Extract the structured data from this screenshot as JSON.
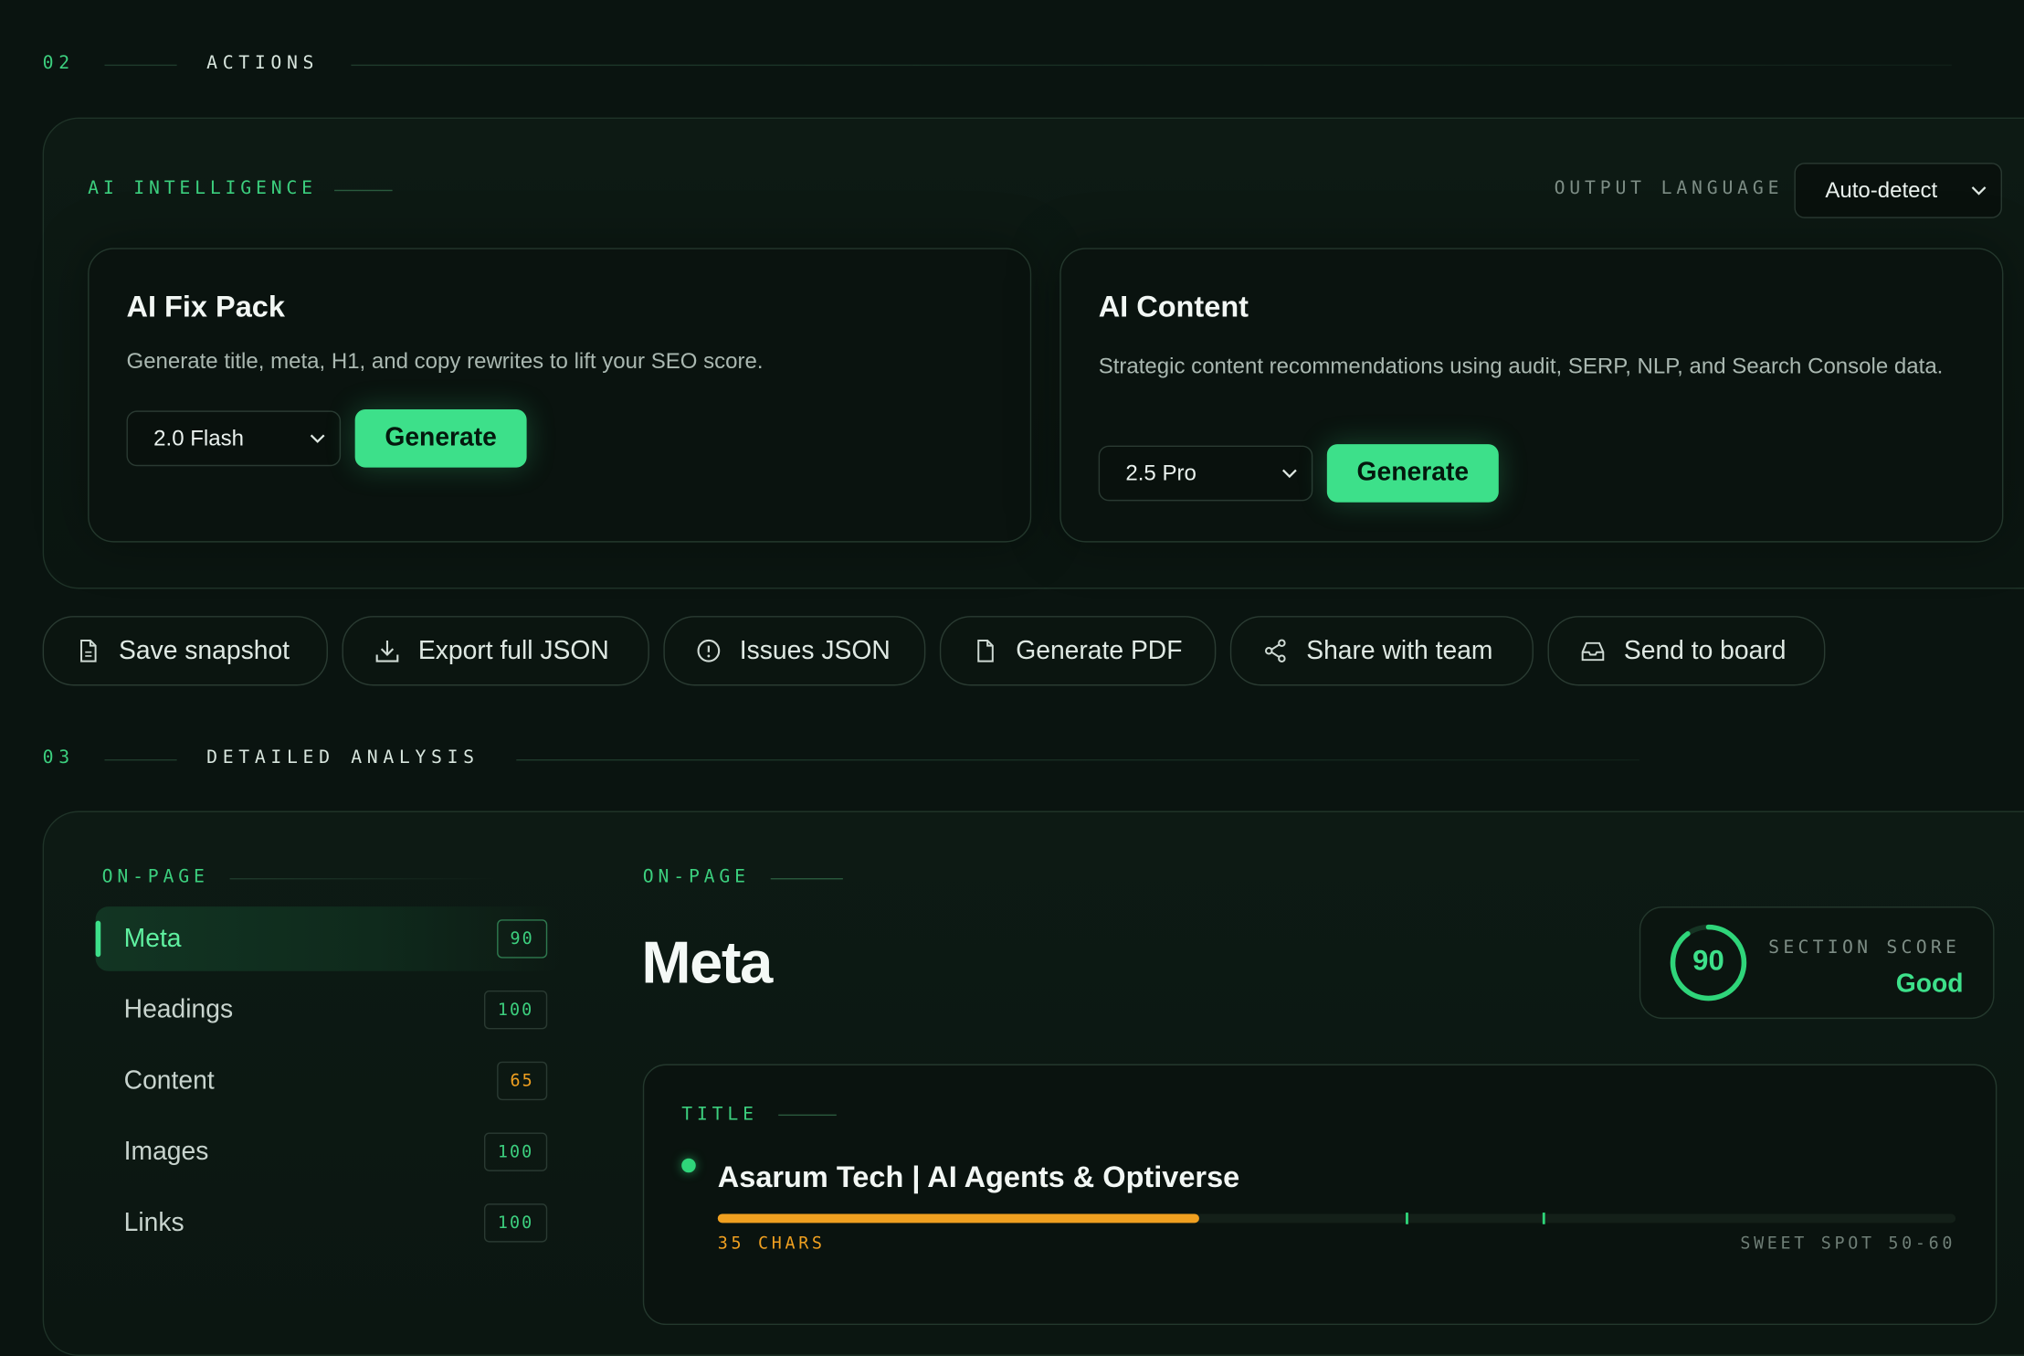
{
  "sections": {
    "actions": {
      "num": "02",
      "title": "ACTIONS"
    },
    "detailed": {
      "num": "03",
      "title": "DETAILED ANALYSIS"
    }
  },
  "ai_panel": {
    "eyebrow": "AI INTELLIGENCE",
    "output_language_label": "OUTPUT LANGUAGE",
    "output_language_value": "Auto-detect",
    "fix_pack": {
      "title": "AI Fix Pack",
      "description": "Generate title, meta, H1, and copy rewrites to lift your SEO score.",
      "model": "2.0 Flash",
      "button": "Generate"
    },
    "content": {
      "title": "AI Content",
      "description": "Strategic content recommendations using audit, SERP, NLP, and Search Console data.",
      "model": "2.5 Pro",
      "button": "Generate"
    }
  },
  "actions": [
    {
      "label": "Save snapshot",
      "icon": "document-icon"
    },
    {
      "label": "Export full JSON",
      "icon": "download-icon"
    },
    {
      "label": "Issues JSON",
      "icon": "alert-circle-icon"
    },
    {
      "label": "Generate PDF",
      "icon": "file-icon"
    },
    {
      "label": "Share with team",
      "icon": "share-icon"
    },
    {
      "label": "Send to board",
      "icon": "inbox-icon"
    }
  ],
  "sidebar": {
    "eyebrow": "ON-PAGE",
    "items": [
      {
        "label": "Meta",
        "score": "90",
        "active": true
      },
      {
        "label": "Headings",
        "score": "100"
      },
      {
        "label": "Content",
        "score": "65"
      },
      {
        "label": "Images",
        "score": "100"
      },
      {
        "label": "Links",
        "score": "100"
      }
    ]
  },
  "detail": {
    "eyebrow": "ON-PAGE",
    "heading": "Meta",
    "score": {
      "value": "90",
      "fraction": 0.9,
      "label": "SECTION SCORE",
      "rating": "Good"
    },
    "title_block": {
      "eyebrow": "TITLE",
      "text": "Asarum Tech | AI Agents & Optiverse",
      "chars": "35 CHARS",
      "sweet_spot": "SWEET SPOT 50-60",
      "length": 35,
      "scale_max": 90,
      "sweet_min": 50,
      "sweet_max": 60
    }
  },
  "colors": {
    "accent": "#3de08a",
    "warning": "#f0a020",
    "background": "#0a1410"
  }
}
